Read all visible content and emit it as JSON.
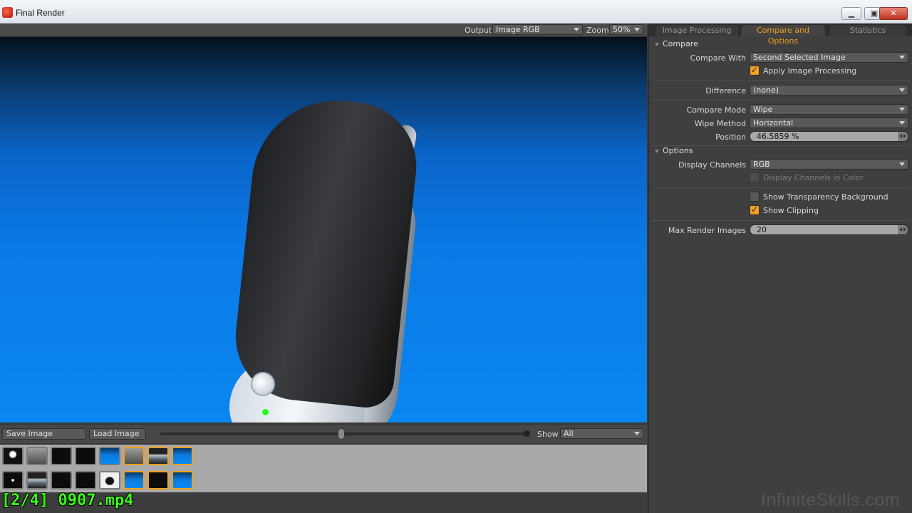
{
  "window": {
    "title": "Final Render"
  },
  "viewer": {
    "output_label": "Output",
    "output_value": "Image RGB",
    "zoom_label": "Zoom",
    "zoom_value": "50%"
  },
  "bottom_bar": {
    "save_label": "Save Image",
    "load_label": "Load Image",
    "show_label": "Show",
    "show_value": "All"
  },
  "thumbnails": {
    "row1": [
      {
        "icon": "bulb",
        "selected": false
      },
      {
        "icon": "gray",
        "selected": false
      },
      {
        "icon": "dark",
        "selected": false
      },
      {
        "icon": "dark",
        "selected": false
      },
      {
        "icon": "blue",
        "selected": false
      },
      {
        "icon": "gray",
        "selected": true
      },
      {
        "icon": "horizon",
        "selected": true
      },
      {
        "icon": "blue",
        "selected": true
      }
    ],
    "row2": [
      {
        "icon": "dot",
        "selected": false
      },
      {
        "icon": "horizon",
        "selected": false
      },
      {
        "icon": "dark",
        "selected": false
      },
      {
        "icon": "dark",
        "selected": false
      },
      {
        "icon": "black-shape",
        "selected": false
      },
      {
        "icon": "blue",
        "selected": true
      },
      {
        "icon": "dark",
        "selected": true
      },
      {
        "icon": "blue",
        "selected": true
      }
    ]
  },
  "overlay_label": "[2/4] 0907.mp4",
  "tabs": [
    {
      "label": "Image Processing",
      "active": false
    },
    {
      "label": "Compare and Options",
      "active": true
    },
    {
      "label": "Statistics",
      "active": false
    }
  ],
  "compare": {
    "section_label": "Compare",
    "compare_with_label": "Compare With",
    "compare_with_value": "Second Selected Image",
    "apply_processing_label": "Apply Image Processing",
    "apply_processing_checked": true,
    "difference_label": "Difference",
    "difference_value": "(none)",
    "compare_mode_label": "Compare Mode",
    "compare_mode_value": "Wipe",
    "wipe_method_label": "Wipe Method",
    "wipe_method_value": "Horizontal",
    "position_label": "Position",
    "position_value": "46.5859 %"
  },
  "options": {
    "section_label": "Options",
    "display_channels_label": "Display Channels",
    "display_channels_value": "RGB",
    "channels_in_color_label": "Display Channels in Color",
    "channels_in_color_checked": false,
    "show_transparency_label": "Show Transparency Background",
    "show_transparency_checked": false,
    "show_clipping_label": "Show Clipping",
    "show_clipping_checked": true,
    "max_render_images_label": "Max Render Images",
    "max_render_images_value": "20"
  },
  "watermark": "InfiniteSkills.com",
  "colors": {
    "accent": "#f0a020",
    "overlay_text": "#39ff14"
  }
}
